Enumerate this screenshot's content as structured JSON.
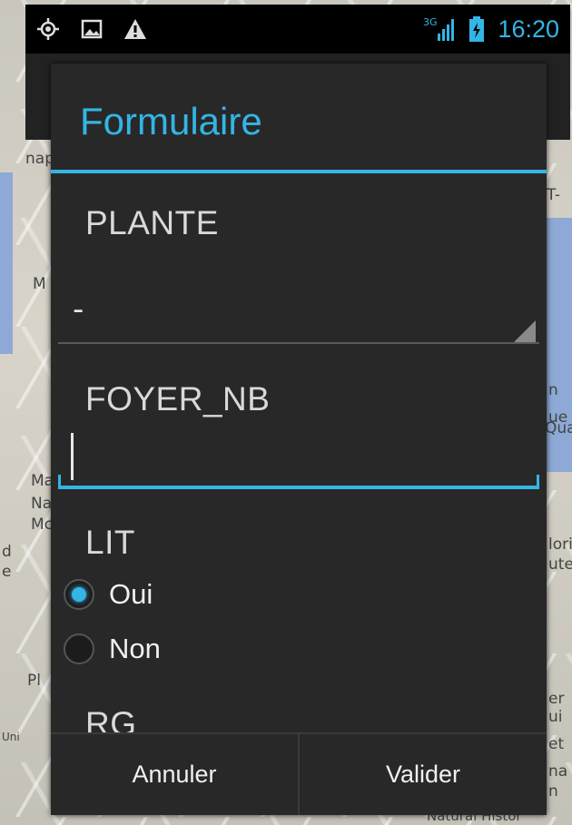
{
  "status_bar": {
    "time": "16:20",
    "network": "3G",
    "icons": [
      "location-icon",
      "image-icon",
      "warning-icon",
      "signal-icon",
      "battery-icon"
    ]
  },
  "map_labels": [
    "nap",
    "M",
    "Ma",
    "Na",
    "Mc",
    "d",
    "e",
    "Pl",
    "er",
    "ui",
    "Uni",
    "et",
    "ue",
    "lori",
    "ute",
    "n",
    "Qua",
    "T-",
    "na",
    "n",
    "Natural Histor"
  ],
  "dialog": {
    "title": "Formulaire",
    "fields": {
      "plante": {
        "label": "PLANTE",
        "value": "-"
      },
      "foyer_nb": {
        "label": "FOYER_NB",
        "value": ""
      },
      "lit": {
        "label": "LIT",
        "options": [
          {
            "label": "Oui",
            "checked": true
          },
          {
            "label": "Non",
            "checked": false
          }
        ]
      },
      "rg": {
        "label": "RG"
      }
    },
    "buttons": {
      "cancel": "Annuler",
      "confirm": "Valider"
    }
  },
  "colors": {
    "accent": "#33b5e5",
    "dialog_bg": "#282828"
  }
}
